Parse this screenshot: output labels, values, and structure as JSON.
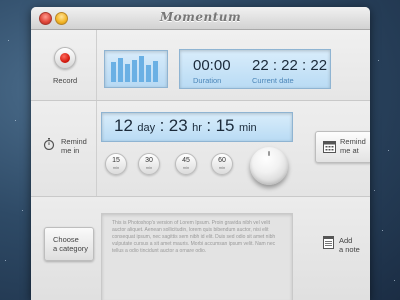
{
  "app": {
    "title": "Momentum"
  },
  "recorder": {
    "record_label": "Record"
  },
  "timer": {
    "duration_value": "00:00",
    "duration_label": "Duration",
    "current_time_value": "22 : 22 : 22",
    "current_time_label": "Current date"
  },
  "reminder": {
    "label_line1": "Remind",
    "label_line2": "me in",
    "days_value": "12",
    "days_unit": "day",
    "hours_value": "23",
    "hours_unit": "hr",
    "minutes_value": "15",
    "minutes_unit": "min",
    "presets": [
      {
        "value": "15",
        "unit": "min"
      },
      {
        "value": "30",
        "unit": "min"
      },
      {
        "value": "45",
        "unit": "min"
      },
      {
        "value": "60",
        "unit": "min"
      }
    ],
    "remind_at_line1": "Remind",
    "remind_at_line2": "me at"
  },
  "notes": {
    "category_line1": "Choose",
    "category_line2": "a category",
    "note_text": "This is Photoshop's version  of Lorem Ipsum. Proin gravida nibh vel velit auctor aliquet. Aenean sollicitudin, lorem quis bibendum auctor, nisi elit consequat ipsum, nec sagittis sem nibh id elit. Duis sed odio sit amet nibh vulputate cursus a sit amet mauris. Morbi accumsan ipsum velit. Nam nec tellus a odio tincidunt auctor a ornare odio.",
    "add_note_line1": "Add",
    "add_note_line2": "a note"
  },
  "icons": {
    "close": "close-button",
    "minimize": "minimize-button",
    "record": "record-icon",
    "equalizer": "equalizer-icon",
    "alarm": "stopwatch-icon",
    "calendar": "calendar-icon",
    "notepad": "notepad-icon",
    "knob": "dial-knob"
  },
  "colors": {
    "record_red": "#d0160b",
    "lcd_background": "#c6e2f7",
    "lcd_accent": "#4c86b8",
    "equalizer_blue": "#6ab0e4"
  }
}
